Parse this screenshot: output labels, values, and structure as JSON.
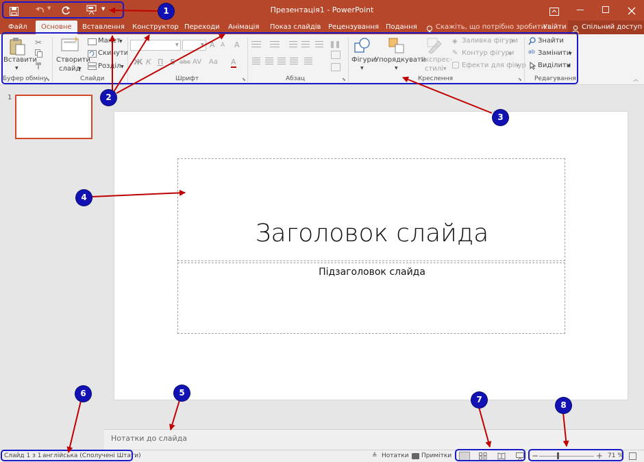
{
  "window": {
    "title": "Презентація1 - PowerPoint"
  },
  "tabs": [
    "Файл",
    "Основне",
    "Вставлення",
    "Конструктор",
    "Переходи",
    "Анімація",
    "Показ слайдів",
    "Рецензування",
    "Подання"
  ],
  "tell_me": "Скажіть, що потрібно зробити...",
  "signin": "Увійти",
  "share": "Спільний доступ",
  "ribbon": {
    "clipboard": {
      "paste": "Вставити",
      "group": "Буфер обміну"
    },
    "slides": {
      "new_slide_1": "Створити",
      "new_slide_2": "слайд",
      "layout": "Макет",
      "reset": "Скинути",
      "section": "Розділ",
      "group": "Слайди"
    },
    "font": {
      "bold": "Ж",
      "italic": "К",
      "underline": "П",
      "shadow": "S",
      "strike": "abc",
      "spacing": "AV",
      "case": "Aa",
      "grow": "A",
      "shrink": "A",
      "clear": "A",
      "color": "A",
      "group": "Шрифт"
    },
    "paragraph": {
      "group": "Абзац"
    },
    "drawing": {
      "shapes": "Фігури",
      "arrange": "Упорядкувати",
      "styles_1": "Експрес-",
      "styles_2": "стилі",
      "fill": "Заливка фігури",
      "outline": "Контур фігури",
      "effects": "Ефекти для фігур",
      "group": "Креслення"
    },
    "editing": {
      "find": "Знайти",
      "replace": "Замінити",
      "select": "Виділити",
      "group": "Редагування"
    }
  },
  "thumbnail": {
    "number": "1"
  },
  "slide": {
    "title": "Заголовок слайда",
    "subtitle": "Підзаголовок слайда"
  },
  "notes": {
    "placeholder": "Нотатки до слайда"
  },
  "status": {
    "slide": "Слайд 1 з 1",
    "language": "англійська (Сполучені Штати)",
    "notes": "Нотатки",
    "comments": "Примітки",
    "zoom": "71 %"
  },
  "callouts": [
    "1",
    "2",
    "3",
    "4",
    "5",
    "6",
    "7",
    "8"
  ],
  "colors": {
    "accent": "#b7472a",
    "callout": "#1212b4",
    "arrow": "#c00000"
  }
}
